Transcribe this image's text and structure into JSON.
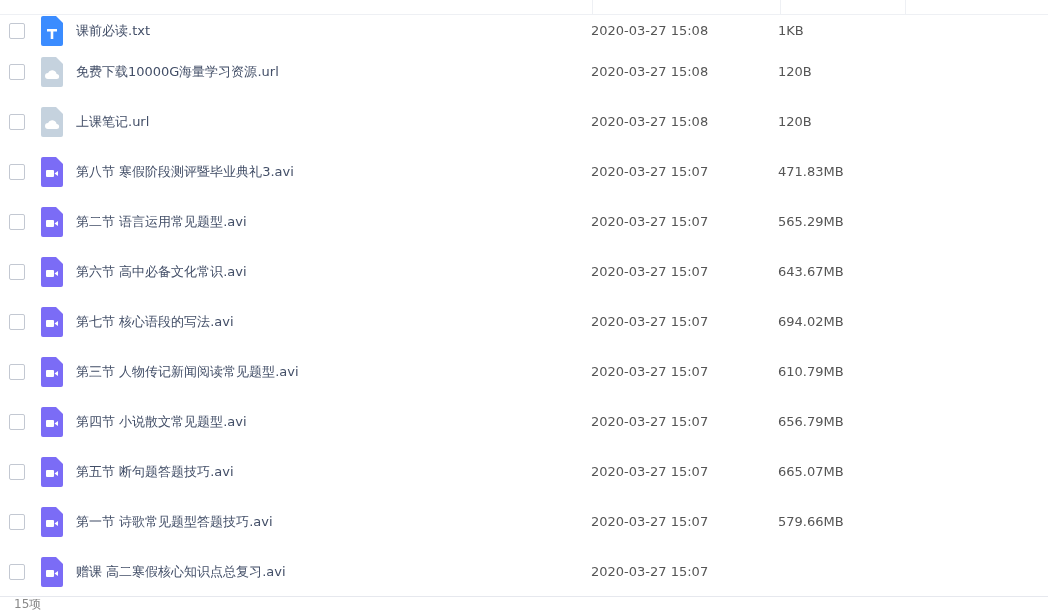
{
  "files": [
    {
      "name": "课前必读.txt",
      "kind": "txt",
      "modified": "2020-03-27 15:08",
      "size": "1KB",
      "checked": false
    },
    {
      "name": "免费下载10000G海量学习资源.url",
      "kind": "url",
      "modified": "2020-03-27 15:08",
      "size": "120B",
      "checked": false
    },
    {
      "name": "上课笔记.url",
      "kind": "url",
      "modified": "2020-03-27 15:08",
      "size": "120B",
      "checked": false
    },
    {
      "name": "第八节 寒假阶段测评暨毕业典礼3.avi",
      "kind": "video",
      "modified": "2020-03-27 15:07",
      "size": "471.83MB",
      "checked": false
    },
    {
      "name": "第二节 语言运用常见题型.avi",
      "kind": "video",
      "modified": "2020-03-27 15:07",
      "size": "565.29MB",
      "checked": false
    },
    {
      "name": "第六节  高中必备文化常识.avi",
      "kind": "video",
      "modified": "2020-03-27 15:07",
      "size": "643.67MB",
      "checked": false
    },
    {
      "name": "第七节 核心语段的写法.avi",
      "kind": "video",
      "modified": "2020-03-27 15:07",
      "size": "694.02MB",
      "checked": false
    },
    {
      "name": "第三节 人物传记新闻阅读常见题型.avi",
      "kind": "video",
      "modified": "2020-03-27 15:07",
      "size": "610.79MB",
      "checked": false
    },
    {
      "name": "第四节 小说散文常见题型.avi",
      "kind": "video",
      "modified": "2020-03-27 15:07",
      "size": "656.79MB",
      "checked": false
    },
    {
      "name": "第五节 断句题答题技巧.avi",
      "kind": "video",
      "modified": "2020-03-27 15:07",
      "size": "665.07MB",
      "checked": false
    },
    {
      "name": "第一节 诗歌常见题型答题技巧.avi",
      "kind": "video",
      "modified": "2020-03-27 15:07",
      "size": "579.66MB",
      "checked": false
    },
    {
      "name": "赠课 高二寒假核心知识点总复习.avi",
      "kind": "video",
      "modified": "2020-03-27 15:07",
      "checked": false
    }
  ],
  "status": {
    "count": "15项"
  }
}
